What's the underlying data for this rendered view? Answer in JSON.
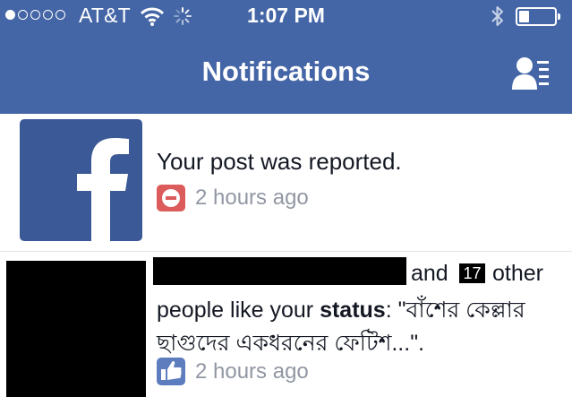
{
  "status_bar": {
    "carrier": "AT&T",
    "time": "1:07 PM",
    "signal_bars_filled": 1,
    "signal_bars_total": 5,
    "battery_level": 0.2
  },
  "nav": {
    "title": "Notifications",
    "right_icon": "friend-requests-icon"
  },
  "notifications": [
    {
      "icon": "facebook-logo",
      "text": "Your post was reported.",
      "badge_icon": "report-icon",
      "time": "2 hours ago"
    },
    {
      "icon": "avatar-redacted",
      "text_and": "and ",
      "count": "17",
      "text_other": "other",
      "text_people_like": "people like your ",
      "text_status": "status",
      "text_quote_start": ": \"বাঁশের কেল্লার",
      "text_quote_end": "ছাগুদের একধরনের ফেটিশ...\".",
      "badge_icon": "like-icon",
      "time": "2 hours ago"
    }
  ],
  "colors": {
    "nav_bar": "#4566a6",
    "facebook_blue": "#3b5997",
    "report_red": "#dc5c5c",
    "like_blue": "#5d7dbf",
    "meta_gray": "#9197a3"
  }
}
